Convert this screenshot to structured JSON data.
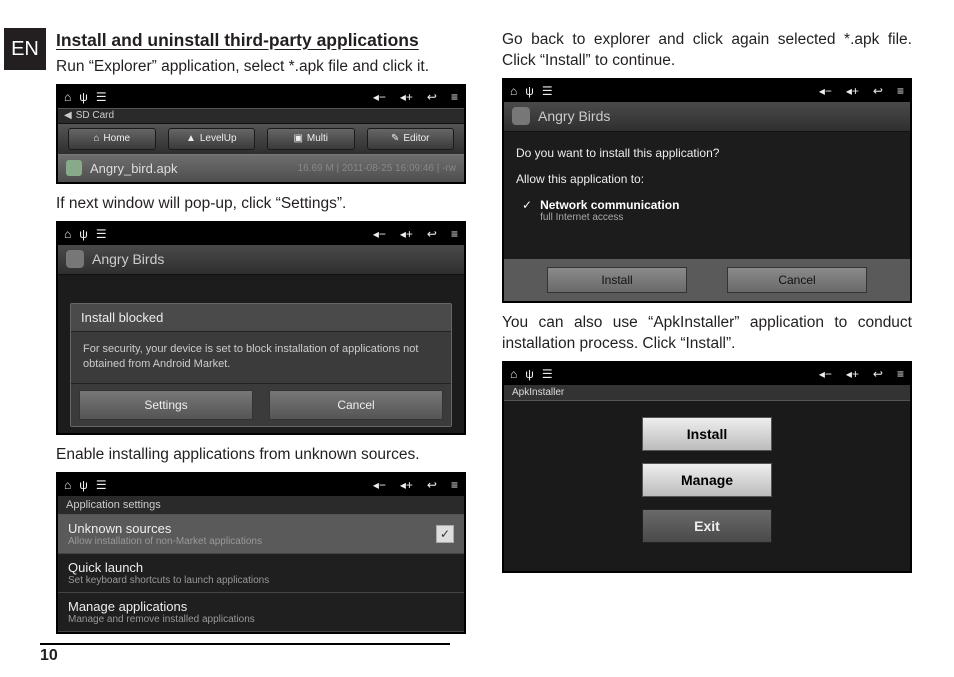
{
  "page": {
    "lang_tab": "EN",
    "number": "10"
  },
  "left": {
    "heading": "Install and uninstall third-party applications",
    "p1": "Run “Explorer” application, select *.apk file and click it.",
    "p2": "If next window will pop-up, click “Settings”.",
    "p3": "Enable installing applications from unknown sources."
  },
  "right": {
    "p1": "Go back to explorer and click again selected *.apk file. Click “Install” to continue.",
    "p2": "You can also use “ApkInstaller” application to conduct installation process. Click “Install”."
  },
  "icons": {
    "home": "⌂",
    "usb": "ψ",
    "menu": "☰",
    "vol_down": "◂−",
    "vol_up": "◂+",
    "back": "↩",
    "list": "≡"
  },
  "shot1": {
    "breadcrumb_icon": "◀",
    "breadcrumb": "SD Card",
    "tabs": [
      "Home",
      "LevelUp",
      "Multi",
      "Editor"
    ],
    "filename": "Angry_bird.apk",
    "meta": "16.69 M | 2011-08-25 16:09:46 | -rw"
  },
  "shot2": {
    "app_title": "Angry Birds",
    "dlg_title": "Install blocked",
    "dlg_msg": "For security, your device is set to block installation of applications not obtained from Android Market.",
    "btn_settings": "Settings",
    "btn_cancel": "Cancel"
  },
  "shot3": {
    "header": "Application settings",
    "items": [
      {
        "t": "Unknown sources",
        "s": "Allow installation of non-Market applications",
        "checked": true
      },
      {
        "t": "Quick launch",
        "s": "Set keyboard shortcuts to launch applications"
      },
      {
        "t": "Manage applications",
        "s": "Manage and remove installed applications"
      }
    ]
  },
  "shot4": {
    "app_title": "Angry Birds",
    "q": "Do you want to install this application?",
    "allow": "Allow this application to:",
    "perm_t": "Network communication",
    "perm_s": "full Internet access",
    "btn_install": "Install",
    "btn_cancel": "Cancel"
  },
  "shot5": {
    "header": "ApkInstaller",
    "btns": [
      "Install",
      "Manage",
      "Exit"
    ]
  }
}
